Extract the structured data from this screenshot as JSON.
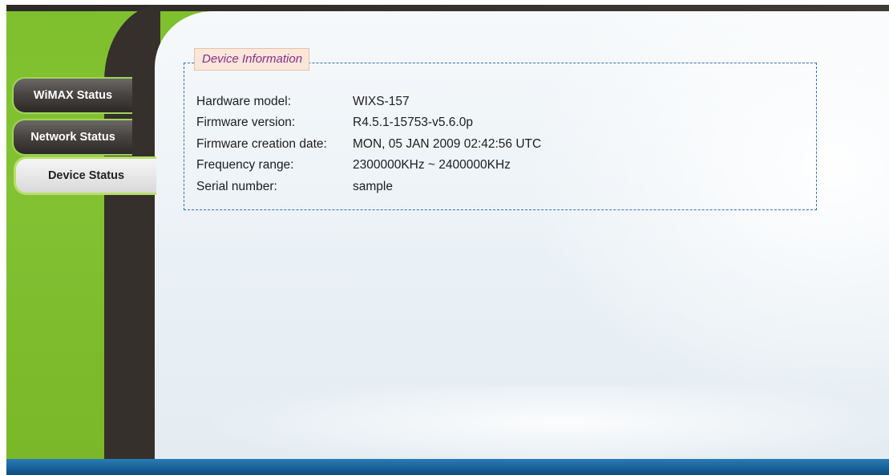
{
  "nav": {
    "items": [
      {
        "label": "WiMAX Status",
        "active": false
      },
      {
        "label": "Network Status",
        "active": false
      },
      {
        "label": "Device Status",
        "active": true
      }
    ]
  },
  "device_info": {
    "legend": "Device Information",
    "rows": [
      {
        "label": "Hardware model:",
        "value": "WIXS-157"
      },
      {
        "label": "Firmware version:",
        "value": "R4.5.1-15753-v5.6.0p"
      },
      {
        "label": "Firmware creation date:",
        "value": "MON, 05 JAN 2009 02:42:56 UTC"
      },
      {
        "label": "Frequency range:",
        "value": "2300000KHz ~ 2400000KHz"
      },
      {
        "label": "Serial number:",
        "value": "sample"
      }
    ]
  },
  "colors": {
    "frame_green": "#7fc02d",
    "dark_column": "#36302c",
    "bottom_bar": "#175f97",
    "legend_text": "#8a2d8a",
    "dashed_border": "#2f73b5"
  }
}
